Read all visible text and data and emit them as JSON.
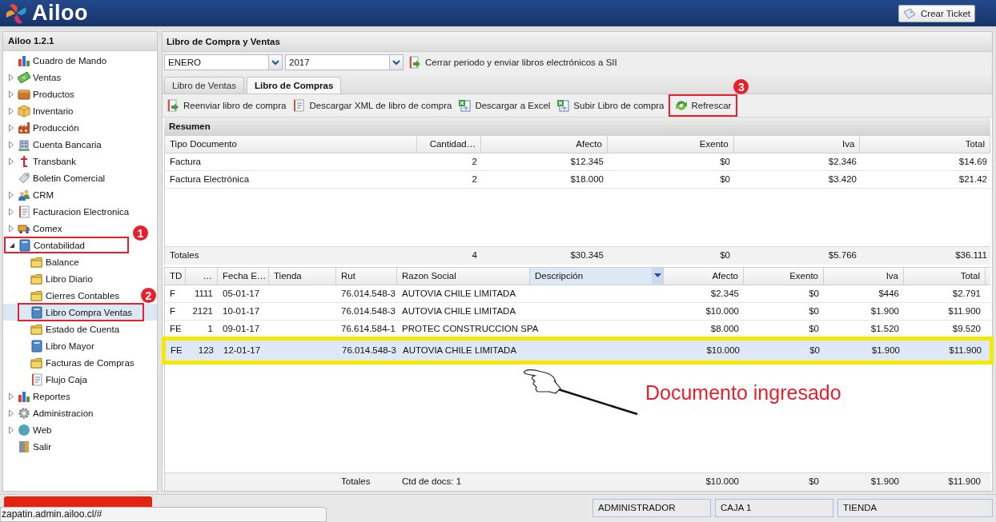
{
  "header": {
    "logo": "Ailoo",
    "button": "Crear Ticket"
  },
  "sidebar": {
    "title": "Ailoo 1.2.1",
    "items": [
      {
        "label": "Cuadro de Mando",
        "kind": "leaf",
        "selected": false
      },
      {
        "label": "Ventas",
        "kind": "branch",
        "expanded": false,
        "selected": false
      },
      {
        "label": "Productos",
        "kind": "branch",
        "expanded": false,
        "selected": false
      },
      {
        "label": "Inventario",
        "kind": "branch",
        "expanded": false,
        "selected": false
      },
      {
        "label": "Producción",
        "kind": "branch",
        "expanded": false,
        "selected": false
      },
      {
        "label": "Cuenta Bancaria",
        "kind": "branch",
        "expanded": false,
        "selected": false
      },
      {
        "label": "Transbank",
        "kind": "branch",
        "expanded": false,
        "selected": false
      },
      {
        "label": "Boletin Comercial",
        "kind": "leaf",
        "selected": false
      },
      {
        "label": "CRM",
        "kind": "branch",
        "expanded": false,
        "selected": false
      },
      {
        "label": "Facturacion Electronica",
        "kind": "branch",
        "expanded": false,
        "selected": false
      },
      {
        "label": "Comex",
        "kind": "branch",
        "expanded": false,
        "selected": false
      },
      {
        "label": "Contabilidad",
        "kind": "branch",
        "expanded": true,
        "selected": false,
        "children": [
          {
            "label": "Balance",
            "selected": false
          },
          {
            "label": "Libro Diario",
            "selected": false
          },
          {
            "label": "Cierres Contables",
            "selected": false
          },
          {
            "label": "Libro Compra Ventas",
            "selected": true
          },
          {
            "label": "Estado de Cuenta",
            "selected": false
          },
          {
            "label": "Libro Mayor",
            "selected": false
          },
          {
            "label": "Facturas de Compras",
            "selected": false
          },
          {
            "label": "Flujo Caja",
            "selected": false
          }
        ]
      },
      {
        "label": "Reportes",
        "kind": "branch",
        "expanded": false,
        "selected": false
      },
      {
        "label": "Administracion",
        "kind": "branch",
        "expanded": false,
        "selected": false
      },
      {
        "label": "Web",
        "kind": "branch",
        "expanded": false,
        "selected": false
      },
      {
        "label": "Salir",
        "kind": "leaf",
        "selected": false
      }
    ]
  },
  "main": {
    "title": "Libro de Compra y Ventas",
    "month": "ENERO",
    "year": "2017",
    "close_button": "Cerrar periodo y enviar libros electrónicos a SII",
    "tabs": [
      {
        "label": "Libro de Ventas",
        "selected": false
      },
      {
        "label": "Libro de Compras",
        "selected": true
      }
    ],
    "toolbar": [
      "Reenviar libro de compra",
      "Descargar XML de libro de compra",
      "Descargar a Excel",
      "Subir Libro de compra",
      "Refrescar"
    ],
    "summary": {
      "title": "Resumen",
      "columns": [
        "Tipo Documento",
        "Cantidad…",
        "Afecto",
        "Exento",
        "Iva",
        "Total"
      ],
      "rows": [
        [
          "Factura",
          "2",
          "$12.345",
          "$0",
          "$2.346",
          "$14.69"
        ],
        [
          "Factura Electrónica",
          "2",
          "$18.000",
          "$0",
          "$3.420",
          "$21.42"
        ]
      ],
      "totals": {
        "label": "Totales",
        "values": [
          "4",
          "$30.345",
          "$0",
          "$5.766",
          "$36.111"
        ]
      }
    },
    "detail": {
      "columns": [
        {
          "label": "TD",
          "active": false
        },
        {
          "label": "…",
          "active": false
        },
        {
          "label": "Fecha E…",
          "active": false
        },
        {
          "label": "Tienda",
          "active": false
        },
        {
          "label": "Rut",
          "active": false
        },
        {
          "label": "Razon Social",
          "active": false
        },
        {
          "label": "Descripción",
          "active": true
        },
        {
          "label": "Afecto",
          "active": false
        },
        {
          "label": "Exento",
          "active": false
        },
        {
          "label": "Iva",
          "active": false
        },
        {
          "label": "Total",
          "active": false
        }
      ],
      "rows": [
        {
          "selected": false,
          "cells": [
            "F",
            "1111",
            "05-01-17",
            "",
            "76.014.548-3",
            "AUTOVIA CHILE LIMITADA",
            "",
            "$2.345",
            "$0",
            "$446",
            "$2.791"
          ]
        },
        {
          "selected": false,
          "cells": [
            "F",
            "2121",
            "10-01-17",
            "",
            "76.014.548-3",
            "AUTOVIA CHILE LIMITADA",
            "",
            "$10.000",
            "$0",
            "$1.900",
            "$11.900"
          ]
        },
        {
          "selected": false,
          "cells": [
            "FE",
            "1",
            "09-01-17",
            "",
            "76.614.584-1",
            "PROTEC CONSTRUCCION SPA",
            "",
            "$8.000",
            "$0",
            "$1.520",
            "$9.520"
          ]
        },
        {
          "selected": true,
          "cells": [
            "FE",
            "123",
            "12-01-17",
            "",
            "76.014.548-3",
            "AUTOVIA CHILE LIMITADA",
            "",
            "$10.000",
            "$0",
            "$1.900",
            "$11.900"
          ]
        }
      ],
      "footer": {
        "label": "Totales",
        "count": "Ctd de docs: 1",
        "values": [
          "$10.000",
          "$0",
          "$1.900",
          "$11.900"
        ]
      }
    }
  },
  "status_bar": {
    "url": "zapatin.admin.ailoo.cl/#",
    "cells": [
      "ADMINISTRADOR",
      "CAJA 1",
      "TIENDA"
    ]
  },
  "annotations": {
    "markers": [
      "1",
      "2",
      "3"
    ],
    "callout": "Documento ingresado"
  }
}
